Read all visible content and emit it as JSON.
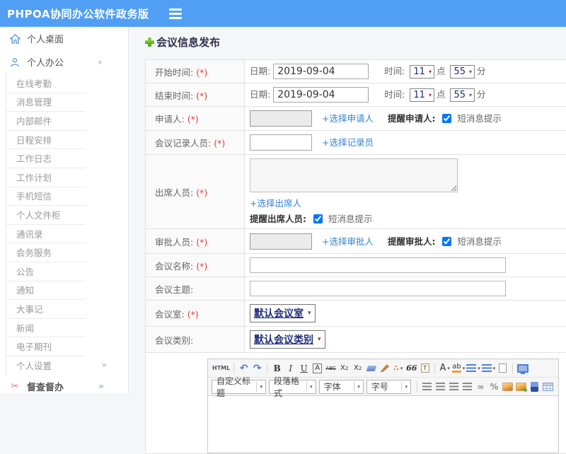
{
  "header": {
    "app_title": "PHPOA协同办公软件政务版"
  },
  "sidebar": {
    "desktop": "个人桌面",
    "office": "个人办公",
    "submenu": [
      "在线考勤",
      "消息管理",
      "内部邮件",
      "日程安排",
      "工作日志",
      "工作计划",
      "手机短信",
      "个人文件柜",
      "通讯录",
      "会务服务",
      "公告",
      "通知",
      "大事记",
      "新闻",
      "电子期刊"
    ],
    "settings": "个人设置",
    "supervision": "督查督办"
  },
  "main": {
    "page_title": "会议信息发布"
  },
  "form": {
    "start_time": {
      "label": "开始时间:",
      "req": "(*)",
      "date_label": "日期:",
      "date": "2019-09-04",
      "time_label": "时间:",
      "hour": "11",
      "hour_unit": "点",
      "minute": "55",
      "minute_unit": "分"
    },
    "end_time": {
      "label": "结束时间:",
      "req": "(*)",
      "date_label": "日期:",
      "date": "2019-09-04",
      "time_label": "时间:",
      "hour": "11",
      "hour_unit": "点",
      "minute": "55",
      "minute_unit": "分"
    },
    "applicant": {
      "label": "申请人:",
      "req": "(*)",
      "link": "+选择申请人",
      "remind": "提醒申请人:",
      "sms": "短消息提示"
    },
    "recorder": {
      "label": "会议记录人员:",
      "req": "(*)",
      "link": "+选择记录员"
    },
    "attendees": {
      "label": "出席人员:",
      "req": "(*)",
      "link": "+选择出席人",
      "remind": "提醒出席人员:",
      "sms": "短消息提示"
    },
    "approver": {
      "label": "审批人员:",
      "req": "(*)",
      "link": "+选择审批人",
      "remind": "提醒审批人:",
      "sms": "短消息提示"
    },
    "name": {
      "label": "会议名称:",
      "req": "(*)"
    },
    "subject": {
      "label": "会议主题:"
    },
    "room": {
      "label": "会议室:",
      "req": "(*)",
      "value": "默认会议室"
    },
    "category": {
      "label": "会议类别:",
      "value": "默认会议类别"
    }
  },
  "editor": {
    "source_btn": "HTML",
    "bold": "B",
    "italic": "I",
    "underline": "U",
    "boxed_a": "A",
    "strike": "ABC",
    "sup_base": "X",
    "sup_exp": "2",
    "sub_base": "X",
    "sub_exp": "2",
    "spray": "∴",
    "quote": "66",
    "font_color": "A",
    "highlight": "ab",
    "link_glyph": "∞",
    "unlink_glyph": "%",
    "combo_title": "自定义标题",
    "combo_paragraph": "段落格式",
    "combo_font": "字体",
    "combo_size": "字号"
  },
  "colors": {
    "header_bg": "#519ff4",
    "link_blue": "#3585d8",
    "required_red": "#ee3333",
    "green_plus": "#55b41d",
    "select_text_navy": "#1f2d7a",
    "sidebar_icon_blue": "#4a90d9",
    "supervision_icon_pink": "#e8708e"
  }
}
